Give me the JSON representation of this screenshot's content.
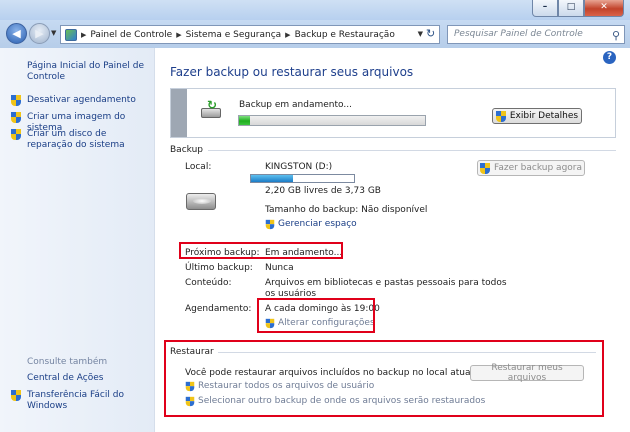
{
  "window": {
    "min_label": "–",
    "max_label": "□",
    "close_label": "✕"
  },
  "address": {
    "crumbs": [
      "Painel de Controle",
      "Sistema e Segurança",
      "Backup e Restauração"
    ],
    "search_placeholder": "Pesquisar Painel de Controle"
  },
  "sidebar": {
    "home_link": "Página Inicial do Painel de Controle",
    "links": [
      "Desativar agendamento",
      "Criar uma imagem do sistema",
      "Criar um disco de reparação do sistema"
    ],
    "see_also_label": "Consulte também",
    "see_also": [
      "Central de Ações",
      "Transferência Fácil do Windows"
    ]
  },
  "main": {
    "title": "Fazer backup ou restaurar seus arquivos",
    "help_label": "?",
    "progress": {
      "label": "Backup em andamento...",
      "fraction": 0.06,
      "details_button": "Exibir Detalhes"
    },
    "backup": {
      "section_label": "Backup",
      "local_label": "Local:",
      "drive_name": "KINGSTON (D:)",
      "drive_used_fraction": 0.41,
      "free_space": "2,20 GB livres de 3,73 GB",
      "backup_size": "Tamanho do backup: Não disponível",
      "manage_space": "Gerenciar espaço",
      "backup_now_button": "Fazer backup agora",
      "next_backup_label": "Próximo backup:",
      "next_backup_value": "Em andamento...",
      "last_backup_label": "Último backup:",
      "last_backup_value": "Nunca",
      "content_label": "Conteúdo:",
      "content_value_1": "Arquivos em bibliotecas e pastas pessoais para todos",
      "content_value_2": "os usuários",
      "schedule_label": "Agendamento:",
      "schedule_value": "A cada domingo às 19:00",
      "change_settings": "Alterar configurações"
    },
    "restore": {
      "section_label": "Restaurar",
      "description": "Você pode restaurar arquivos incluídos no backup no local atual.",
      "restore_button": "Restaurar meus arquivos",
      "restore_all_users": "Restaurar todos os arquivos de usuário",
      "select_other_backup": "Selecionar outro backup de onde os arquivos serão restaurados"
    }
  },
  "colors": {
    "link": "#1a3e86",
    "title": "#1e3f8c",
    "highlight_box": "#e0001a",
    "progress_green": "#1fae1f"
  }
}
